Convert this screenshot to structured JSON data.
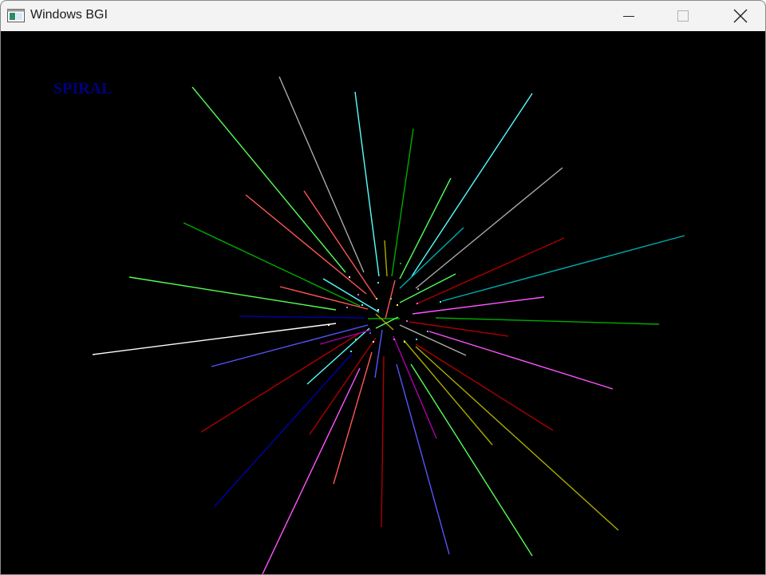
{
  "window": {
    "title": "Windows BGI",
    "icons": {
      "app": "app-window-icon",
      "minimize": "minimize-icon",
      "maximize": "maximize-icon",
      "close": "close-icon"
    }
  },
  "canvas": {
    "heading": "SPIRAL",
    "heading_color": "#000080",
    "background": "#000000",
    "figure": "radial burst of colored line segments"
  }
}
